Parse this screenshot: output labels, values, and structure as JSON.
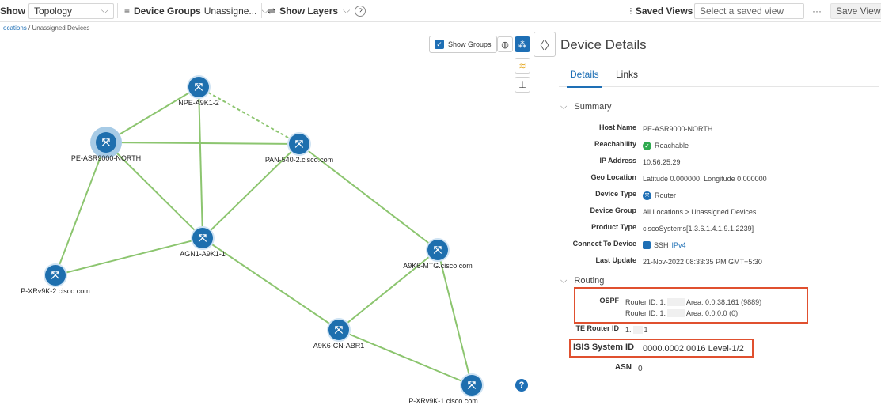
{
  "toolbar": {
    "show_label": "Show",
    "show_value": "Topology",
    "groups_label": "Device Groups",
    "groups_value": "Unassigne...",
    "layers_label": "Show Layers",
    "help": "?",
    "saved_views_label": "Saved Views",
    "saved_view_placeholder": "Select a saved view",
    "more": "···",
    "save_view": "Save View"
  },
  "breadcrumb": {
    "parent": "ocations",
    "separator": " / ",
    "current": "Unassigned Devices"
  },
  "map": {
    "show_groups_label": "Show Groups",
    "help_label": "?",
    "nodes": [
      {
        "label": "NPE-A9K1-2"
      },
      {
        "label": "PE-ASR9000-NORTH",
        "selected": true
      },
      {
        "label": "PAN-540-2.cisco.com"
      },
      {
        "label": "AGN1-A9K1-1"
      },
      {
        "label": "A9K6-MTG.cisco.com"
      },
      {
        "label": "P-XRv9K-2.cisco.com"
      },
      {
        "label": "A9K6-CN-ABR1"
      },
      {
        "label": "P-XRv9K-1.cisco.com"
      }
    ],
    "link_color": "#8cc56f",
    "node_color": "#1e6fae"
  },
  "panel": {
    "title": "Device Details",
    "tabs": [
      "Details",
      "Links"
    ],
    "summary_heading": "Summary",
    "summary": [
      {
        "key": "Host Name",
        "value": "PE-ASR9000-NORTH"
      },
      {
        "key": "Reachability",
        "value": "Reachable"
      },
      {
        "key": "IP Address",
        "value": "10.56.25.29"
      },
      {
        "key": "Geo Location",
        "value": "Latitude 0.000000, Longitude 0.000000"
      },
      {
        "key": "Device Type",
        "value": "Router"
      },
      {
        "key": "Device Group",
        "value": "All Locations > Unassigned Devices"
      },
      {
        "key": "Product Type",
        "value": "ciscoSystems[1.3.6.1.4.1.9.1.2239]"
      },
      {
        "key": "Connect To Device",
        "value": "SSH",
        "link": "IPv4"
      },
      {
        "key": "Last Update",
        "value": "21-Nov-2022 08:33:35 PM GMT+5:30"
      }
    ],
    "routing_heading": "Routing",
    "ospf": {
      "key": "OSPF",
      "line1_prefix": "Router ID: 1.",
      "line1_area": "Area: 0.0.38.161 (9889)",
      "line2_prefix": "Router ID: 1.",
      "line2_area": "Area: 0.0.0.0 (0)"
    },
    "te_router": {
      "key": "TE Router ID",
      "prefix": "1.",
      "suffix": "1"
    },
    "isis": {
      "key": "ISIS System ID",
      "value": "0000.0002.0016 Level-1/2"
    },
    "asn": {
      "key": "ASN",
      "value": "0"
    }
  }
}
